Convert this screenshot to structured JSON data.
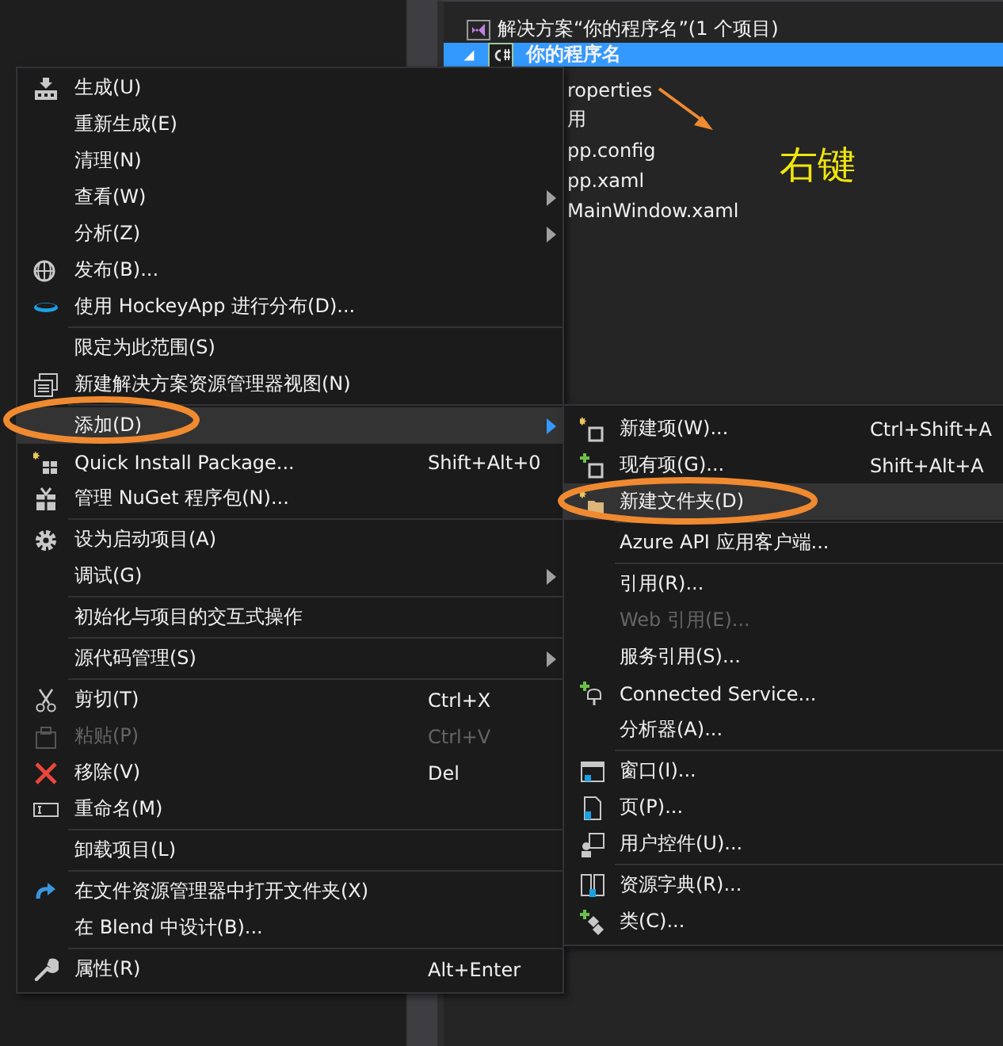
{
  "solution_explorer": {
    "items": [
      {
        "label": "解决方案“你的程序名”(1 个项目)",
        "selected": false,
        "children": [
          {
            "label": "你的程序名",
            "selected": true,
            "expanded": true,
            "children": [
              {
                "label": "roperties",
                "selected": false
              },
              {
                "label": "用",
                "selected": false
              },
              {
                "label": "pp.config",
                "selected": false
              },
              {
                "label": "pp.xaml",
                "selected": false
              },
              {
                "label": "MainWindow.xaml",
                "selected": false
              }
            ]
          }
        ]
      }
    ]
  },
  "annotation": {
    "label": "右键"
  },
  "context_menu": {
    "items": [
      {
        "kind": "item",
        "label": "生成(U)",
        "submenu": false,
        "selected": false,
        "disabled": false
      },
      {
        "kind": "item",
        "label": "重新生成(E)",
        "submenu": false,
        "selected": false,
        "disabled": false
      },
      {
        "kind": "item",
        "label": "清理(N)",
        "submenu": false,
        "selected": false,
        "disabled": false
      },
      {
        "kind": "item",
        "label": "查看(W)",
        "submenu": true,
        "selected": false,
        "disabled": false
      },
      {
        "kind": "item",
        "label": "分析(Z)",
        "submenu": true,
        "selected": false,
        "disabled": false
      },
      {
        "kind": "item",
        "label": "发布(B)...",
        "submenu": false,
        "selected": false,
        "disabled": false
      },
      {
        "kind": "item",
        "label": "使用 HockeyApp 进行分布(D)...",
        "submenu": false,
        "selected": false,
        "disabled": false
      },
      {
        "kind": "separator"
      },
      {
        "kind": "item",
        "label": "限定为此范围(S)",
        "submenu": false,
        "selected": false,
        "disabled": false
      },
      {
        "kind": "item",
        "label": "新建解决方案资源管理器视图(N)",
        "submenu": false,
        "selected": false,
        "disabled": false
      },
      {
        "kind": "separator"
      },
      {
        "kind": "item",
        "label": "添加(D)",
        "submenu": true,
        "selected": true,
        "disabled": false
      },
      {
        "kind": "item",
        "label": "Quick Install Package...",
        "shortcut": "Shift+Alt+0",
        "submenu": false,
        "selected": false,
        "disabled": false
      },
      {
        "kind": "item",
        "label": "管理 NuGet 程序包(N)...",
        "submenu": false,
        "selected": false,
        "disabled": false
      },
      {
        "kind": "separator"
      },
      {
        "kind": "item",
        "label": "设为启动项目(A)",
        "submenu": false,
        "selected": false,
        "disabled": false
      },
      {
        "kind": "item",
        "label": "调试(G)",
        "submenu": true,
        "selected": false,
        "disabled": false
      },
      {
        "kind": "separator"
      },
      {
        "kind": "item",
        "label": "初始化与项目的交互式操作",
        "submenu": false,
        "selected": false,
        "disabled": false
      },
      {
        "kind": "separator"
      },
      {
        "kind": "item",
        "label": "源代码管理(S)",
        "submenu": true,
        "selected": false,
        "disabled": false
      },
      {
        "kind": "separator"
      },
      {
        "kind": "item",
        "label": "剪切(T)",
        "shortcut": "Ctrl+X",
        "submenu": false,
        "selected": false,
        "disabled": false
      },
      {
        "kind": "item",
        "label": "粘贴(P)",
        "shortcut": "Ctrl+V",
        "submenu": false,
        "selected": false,
        "disabled": true
      },
      {
        "kind": "item",
        "label": "移除(V)",
        "shortcut": "Del",
        "submenu": false,
        "selected": false,
        "disabled": false
      },
      {
        "kind": "item",
        "label": "重命名(M)",
        "submenu": false,
        "selected": false,
        "disabled": false
      },
      {
        "kind": "separator"
      },
      {
        "kind": "item",
        "label": "卸载项目(L)",
        "submenu": false,
        "selected": false,
        "disabled": false
      },
      {
        "kind": "separator"
      },
      {
        "kind": "item",
        "label": "在文件资源管理器中打开文件夹(X)",
        "submenu": false,
        "selected": false,
        "disabled": false
      },
      {
        "kind": "item",
        "label": "在 Blend 中设计(B)...",
        "submenu": false,
        "selected": false,
        "disabled": false
      },
      {
        "kind": "separator"
      },
      {
        "kind": "item",
        "label": "属性(R)",
        "shortcut": "Alt+Enter",
        "submenu": false,
        "selected": false,
        "disabled": false
      }
    ]
  },
  "submenu": {
    "items": [
      {
        "kind": "item",
        "label": "新建项(W)...",
        "shortcut": "Ctrl+Shift+A",
        "selected": false,
        "disabled": false
      },
      {
        "kind": "item",
        "label": "现有项(G)...",
        "shortcut": "Shift+Alt+A",
        "selected": false,
        "disabled": false
      },
      {
        "kind": "item",
        "label": "新建文件夹(D)",
        "selected": true,
        "disabled": false
      },
      {
        "kind": "separator"
      },
      {
        "kind": "item",
        "label": "Azure API 应用客户端...",
        "selected": false,
        "disabled": false
      },
      {
        "kind": "separator"
      },
      {
        "kind": "item",
        "label": "引用(R)...",
        "selected": false,
        "disabled": false
      },
      {
        "kind": "item",
        "label": "Web 引用(E)...",
        "selected": false,
        "disabled": true
      },
      {
        "kind": "item",
        "label": "服务引用(S)...",
        "selected": false,
        "disabled": false
      },
      {
        "kind": "item",
        "label": "Connected Service...",
        "selected": false,
        "disabled": false
      },
      {
        "kind": "item",
        "label": "分析器(A)...",
        "selected": false,
        "disabled": false
      },
      {
        "kind": "separator"
      },
      {
        "kind": "item",
        "label": "窗口(I)...",
        "selected": false,
        "disabled": false
      },
      {
        "kind": "item",
        "label": "页(P)...",
        "selected": false,
        "disabled": false
      },
      {
        "kind": "item",
        "label": "用户控件(U)...",
        "selected": false,
        "disabled": false
      },
      {
        "kind": "separator"
      },
      {
        "kind": "item",
        "label": "资源字典(R)...",
        "selected": false,
        "disabled": false
      },
      {
        "kind": "item",
        "label": "类(C)...",
        "selected": false,
        "disabled": false
      }
    ]
  }
}
